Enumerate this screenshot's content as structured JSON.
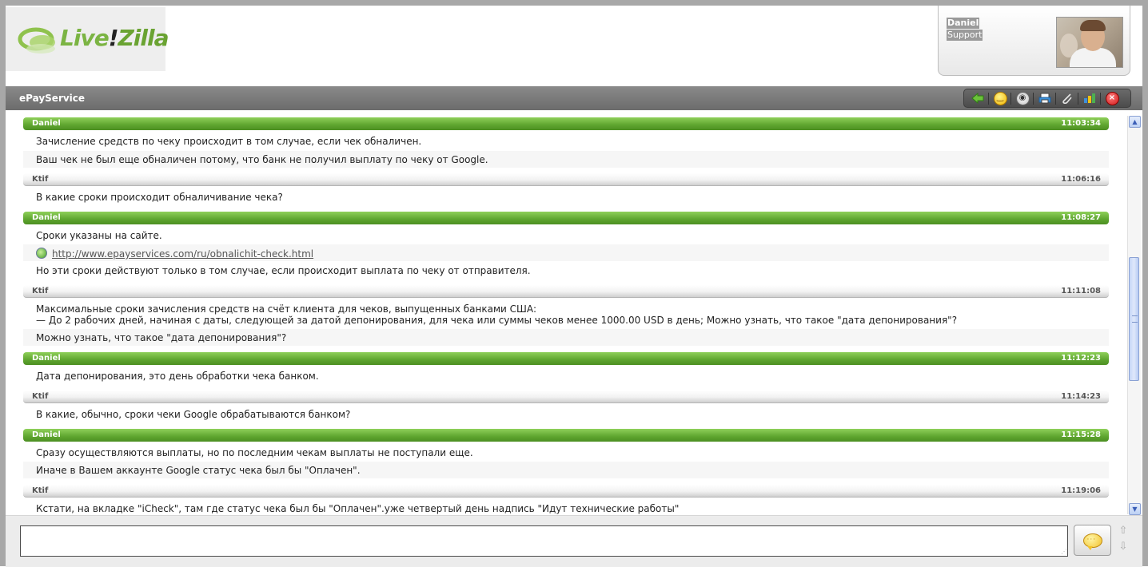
{
  "header": {
    "logo": {
      "part1": "Live",
      "part2": "!",
      "part3": "Zilla"
    },
    "operator": {
      "name": "Daniel",
      "role": "Support"
    }
  },
  "titlebar": {
    "title": "ePayService"
  },
  "toolbar": {
    "icons": [
      "back-arrow-icon",
      "smiley-icon",
      "sound-icon",
      "print-icon",
      "attach-icon",
      "rating-icon",
      "close-icon"
    ]
  },
  "colors": {
    "operator_header": "#5ea52f",
    "visitor_header": "#e8e8e8",
    "titlebar": "#777777"
  },
  "messages": [
    {
      "author": "Daniel",
      "time": "11:03:34",
      "type": "operator",
      "lines": [
        "Зачисление средств по чеку происходит в том случае, если чек обналичен.",
        "Ваш чек не был еще обналичен потому, что банк не получил выплату по чеку от Google."
      ]
    },
    {
      "author": "Ktif",
      "time": "11:06:16",
      "type": "visitor",
      "lines": [
        "В какие сроки происходит обналичивание чека?"
      ]
    },
    {
      "author": "Daniel",
      "time": "11:08:27",
      "type": "operator",
      "lines": [
        "Сроки указаны на сайте.",
        "http://www.epayservices.com/ru/obnalichit-check.html",
        "Но эти сроки действуют только в том случае, если происходит выплата по чеку от отправителя."
      ]
    },
    {
      "author": "Ktif",
      "time": "11:11:08",
      "type": "visitor",
      "lines": [
        "Максимальные сроки зачисления средств на счёт клиента для чеков, выпущенных банками США:",
        "— До 2 рабочих дней, начиная с даты, следующей за датой депонирования, для чека или суммы чеков менее 1000.00 USD в день; Можно узнать, что такое \"дата депонирования\"?",
        "Можно узнать, что такое \"дата депонирования\"?"
      ]
    },
    {
      "author": "Daniel",
      "time": "11:12:23",
      "type": "operator",
      "lines": [
        "Дата депонирования, это день обработки чека банком."
      ]
    },
    {
      "author": "Ktif",
      "time": "11:14:23",
      "type": "visitor",
      "lines": [
        "В какие, обычно, сроки чеки Google обрабатываются банком?"
      ]
    },
    {
      "author": "Daniel",
      "time": "11:15:28",
      "type": "operator",
      "lines": [
        "Сразу осуществляются выплаты, но по последним чекам выплаты не поступали еще.",
        "Иначе в Вашем аккаунте Google статус чека был бы \"Оплачен\"."
      ]
    },
    {
      "author": "Ktif",
      "time": "11:19:06",
      "type": "visitor",
      "lines": [
        "Кстати, на вкладке \"iCheck\", там где статус чека был бы \"Оплачен\".уже четвертый день надпись \"Идут технические работы\""
      ]
    }
  ],
  "input": {
    "value": ""
  }
}
